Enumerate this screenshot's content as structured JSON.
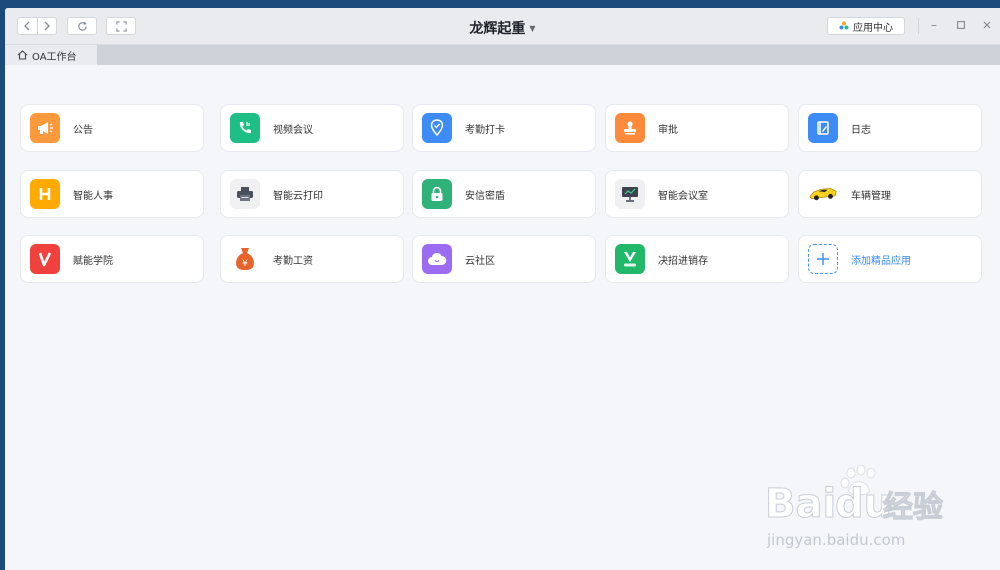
{
  "window": {
    "title": "龙辉起重"
  },
  "toolbar": {
    "app_center_label": "应用中心"
  },
  "tabs": [
    {
      "label": "OA工作台"
    }
  ],
  "apps": [
    {
      "label": "公告",
      "icon": "megaphone-icon",
      "color": "#ff9a3c"
    },
    {
      "label": "视频会议",
      "icon": "phone-icon",
      "color": "#1dbf85"
    },
    {
      "label": "考勤打卡",
      "icon": "location-pin-icon",
      "color": "#3d8cf5"
    },
    {
      "label": "审批",
      "icon": "stamp-icon",
      "color": "#ff8a3c"
    },
    {
      "label": "日志",
      "icon": "notebook-icon",
      "color": "#3d8cf5"
    },
    {
      "label": "智能人事",
      "icon": "hr-h-icon",
      "color": "#ffaa00"
    },
    {
      "label": "智能云打印",
      "icon": "printer-icon",
      "color": "#f0f0f2"
    },
    {
      "label": "安信密盾",
      "icon": "lock-icon",
      "color": "#2fb27a"
    },
    {
      "label": "智能会议室",
      "icon": "monitor-icon",
      "color": "#f0f0f2"
    },
    {
      "label": "车辆管理",
      "icon": "car-icon",
      "color": "#ffd21f"
    },
    {
      "label": "赋能学院",
      "icon": "v-logo-icon",
      "color": "#f0413c"
    },
    {
      "label": "考勤工资",
      "icon": "money-bag-icon",
      "color": "#e8622c"
    },
    {
      "label": "云社区",
      "icon": "cloud-icon",
      "color": "#9b6cf2"
    },
    {
      "label": "决招进销存",
      "icon": "v-badge-icon",
      "color": "#22b86a"
    }
  ],
  "add_app": {
    "label": "添加精品应用"
  },
  "watermark": {
    "brand_a": "Bai",
    "brand_b": "du",
    "brand_c": "经验",
    "url": "jingyan.baidu.com"
  }
}
